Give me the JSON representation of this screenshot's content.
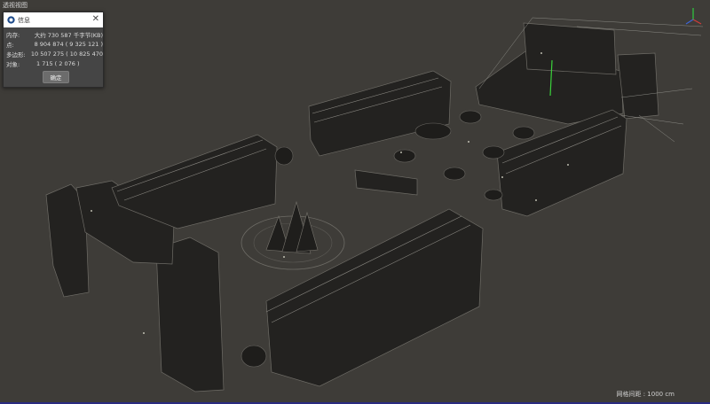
{
  "viewport": {
    "title": "透视视图",
    "grid_spacing": "网格间距 : 1000 cm"
  },
  "info_dialog": {
    "title": "信息",
    "icon": "cinema4d-logo-icon",
    "close_glyph": "✕",
    "rows": [
      {
        "label": "内存:",
        "value": "大约 730 587 千字节(KB)"
      },
      {
        "label": "点:",
        "value": "8 904 874 ( 9 325 121 )"
      },
      {
        "label": "多边形:",
        "value": "10 507 275 ( 10 825 470"
      },
      {
        "label": "对象:",
        "value": "1 715 ( 2 076 )"
      }
    ],
    "ok_label": "确定"
  },
  "axis_gizmo": {
    "icon": "axis-gizmo-icon",
    "y_color": "#2ecc40",
    "x_color": "#d23b3b",
    "z_color": "#3c64d8"
  },
  "scene": {
    "icon": "festival-scene-3d-render",
    "selection_color": "#3ad13a"
  }
}
